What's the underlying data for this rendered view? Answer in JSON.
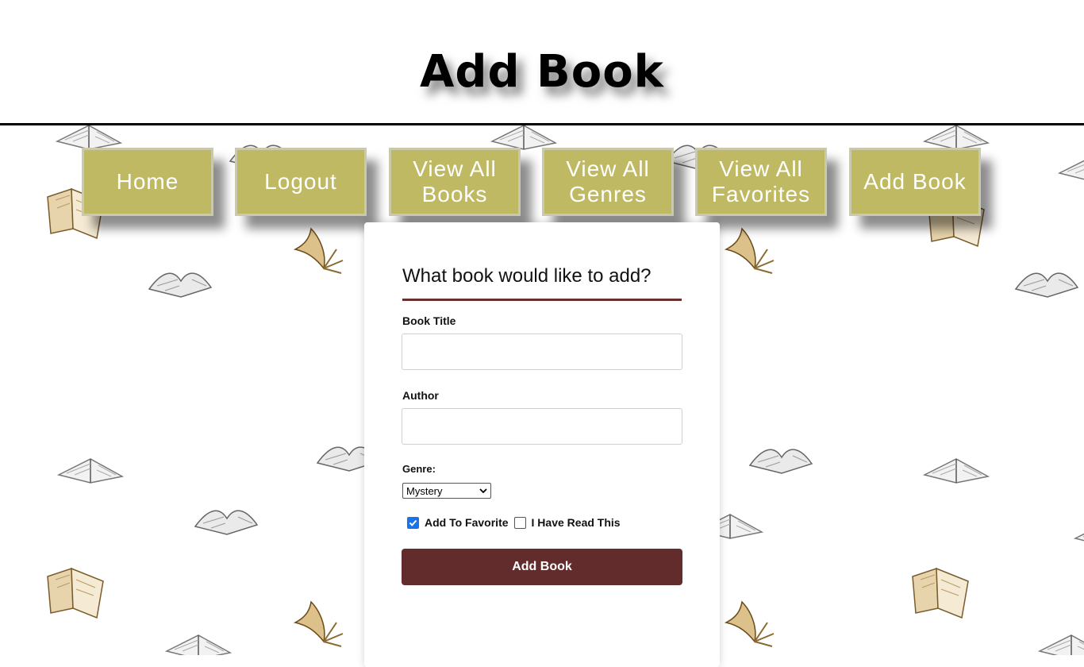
{
  "header": {
    "title": "Add Book"
  },
  "nav": {
    "items": [
      {
        "label": "Home"
      },
      {
        "label": "Logout"
      },
      {
        "label": "View All Books"
      },
      {
        "label": "View All Genres"
      },
      {
        "label": "View All Favorites"
      },
      {
        "label": "Add Book"
      }
    ],
    "color": "#bfb964"
  },
  "form": {
    "heading": "What book would like to add?",
    "title_label": "Book Title",
    "title_value": "",
    "author_label": "Author",
    "author_value": "",
    "genre_label": "Genre:",
    "genre_selected": "Mystery",
    "favorite_label": "Add To Favorite",
    "favorite_checked": true,
    "read_label": "I Have Read This",
    "read_checked": false,
    "submit_label": "Add Book",
    "accent_color": "#632c2c"
  }
}
